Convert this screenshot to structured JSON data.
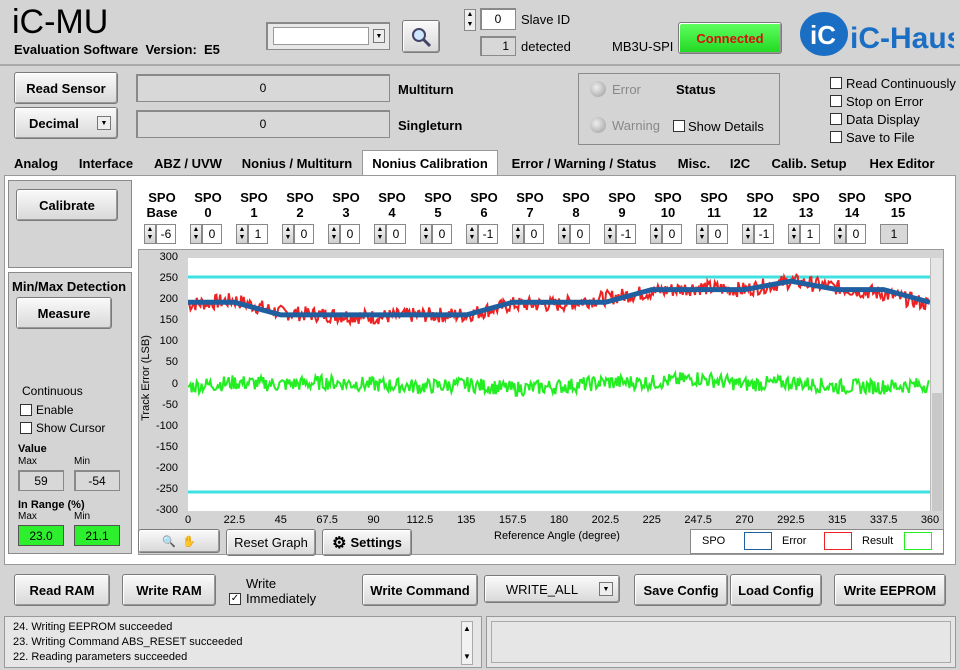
{
  "header": {
    "app_title": "iC-MU",
    "subtitle": "Evaluation Software  Version:  E5",
    "slave_id_label": "Slave ID",
    "slave_id_value": "0",
    "detected_label": "detected",
    "detected_value": "1",
    "interface_label": "MB3U-SPI",
    "connected_label": "Connected",
    "device_select_value": "",
    "logo_text": "iC-Haus"
  },
  "sensor": {
    "read_sensor_label": "Read Sensor",
    "decimal_label": "Decimal",
    "multiturn_value": "0",
    "multiturn_label": "Multiturn",
    "singleturn_value": "0",
    "singleturn_label": "Singleturn"
  },
  "status": {
    "error_label": "Error",
    "warning_label": "Warning",
    "status_label": "Status",
    "show_details_label": "Show Details"
  },
  "options": {
    "read_continuously": "Read Continuously",
    "stop_on_error": "Stop on Error",
    "data_display": "Data Display",
    "save_to_file": "Save to File"
  },
  "tabs": [
    "Analog",
    "Interface",
    "ABZ / UVW",
    "Nonius / Multiturn",
    "Nonius Calibration",
    "Error / Warning / Status",
    "Misc.",
    "I2C",
    "Calib. Setup",
    "Hex Editor"
  ],
  "left_panel": {
    "calibrate_label": "Calibrate",
    "minmax_title": "Min/Max Detection",
    "measure_label": "Measure",
    "continuous_label": "Continuous",
    "enable_label": "Enable",
    "show_cursor_label": "Show Cursor",
    "value_label": "Value",
    "max_label": "Max",
    "min_label": "Min",
    "value_max": "59",
    "value_min": "-54",
    "in_range_label": "In Range (%)",
    "range_max_label": "Max",
    "range_min_label": "Min",
    "range_max": "23.0",
    "range_min": "21.1"
  },
  "spo": {
    "headers": [
      "SPO Base",
      "SPO 0",
      "SPO 1",
      "SPO 2",
      "SPO 3",
      "SPO 4",
      "SPO 5",
      "SPO 6",
      "SPO 7",
      "SPO 8",
      "SPO 9",
      "SPO 10",
      "SPO 11",
      "SPO 12",
      "SPO 13",
      "SPO 14",
      "SPO 15"
    ],
    "values": [
      "-6",
      "0",
      "1",
      "0",
      "0",
      "0",
      "0",
      "-1",
      "0",
      "0",
      "-1",
      "0",
      "0",
      "-1",
      "1",
      "0",
      "1"
    ]
  },
  "graph_controls": {
    "reset_graph_label": "Reset Graph",
    "settings_label": "Settings",
    "legend_spo": "SPO",
    "legend_error": "Error",
    "legend_result": "Result"
  },
  "chart_data": {
    "type": "line",
    "xlabel": "Reference Angle (degree)",
    "ylabel": "Track Error (LSB)",
    "xlim": [
      0,
      360
    ],
    "ylim": [
      -300,
      300
    ],
    "x_ticks": [
      "0",
      "22.5",
      "45",
      "67.5",
      "90",
      "112.5",
      "135",
      "157.5",
      "180",
      "202.5",
      "225",
      "247.5",
      "270",
      "292.5",
      "315",
      "337.5",
      "360"
    ],
    "y_ticks": [
      "300",
      "250",
      "200",
      "150",
      "100",
      "50",
      "0",
      "-50",
      "-100",
      "-150",
      "-200",
      "-250",
      "-300"
    ],
    "limit_lines": [
      255,
      -255
    ],
    "series": [
      {
        "name": "SPO",
        "color": "#1f5fa0",
        "x": [
          0,
          22.5,
          45,
          67.5,
          90,
          112.5,
          135,
          157.5,
          180,
          202.5,
          225,
          247.5,
          270,
          292.5,
          315,
          337.5,
          360
        ],
        "values": [
          195,
          195,
          165,
          165,
          165,
          165,
          165,
          195,
          195,
          195,
          225,
          225,
          225,
          245,
          225,
          225,
          195
        ]
      },
      {
        "name": "Error",
        "color": "#ee2222",
        "x": [
          0,
          22.5,
          45,
          67.5,
          90,
          112.5,
          135,
          157.5,
          180,
          202.5,
          225,
          247.5,
          270,
          292.5,
          315,
          337.5,
          360
        ],
        "values": [
          190,
          200,
          170,
          165,
          160,
          165,
          165,
          190,
          190,
          205,
          220,
          230,
          225,
          245,
          230,
          215,
          190
        ]
      },
      {
        "name": "Result",
        "color": "#22ee22",
        "x": [
          0,
          22.5,
          45,
          67.5,
          90,
          112.5,
          135,
          157.5,
          180,
          202.5,
          225,
          247.5,
          270,
          292.5,
          315,
          337.5,
          360
        ],
        "values": [
          -5,
          5,
          0,
          5,
          0,
          -5,
          0,
          -10,
          -5,
          5,
          5,
          15,
          0,
          5,
          -5,
          -5,
          0
        ]
      }
    ]
  },
  "bottom": {
    "read_ram": "Read RAM",
    "write_ram": "Write RAM",
    "write_immediately": "Write Immediately",
    "write_command": "Write Command",
    "command_select": "WRITE_ALL",
    "save_config": "Save Config",
    "load_config": "Load Config",
    "write_eeprom": "Write EEPROM"
  },
  "log": [
    "24. Writing EEPROM succeeded",
    "23. Writing Command ABS_RESET succeeded",
    "22. Reading parameters succeeded"
  ]
}
